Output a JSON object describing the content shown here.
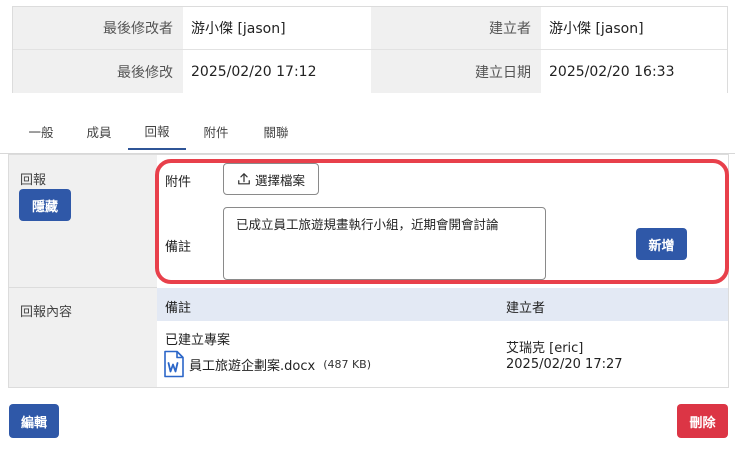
{
  "info": {
    "modifier_label": "最後修改者",
    "modifier_value": "游小傑 [jason]",
    "creator_label": "建立者",
    "creator_value": "游小傑 [jason]",
    "modified_label": "最後修改",
    "modified_value": "2025/02/20 17:12",
    "created_label": "建立日期",
    "created_value": "2025/02/20 16:33"
  },
  "tabs": [
    {
      "label": "一般",
      "active": false
    },
    {
      "label": "成員",
      "active": false
    },
    {
      "label": "回報",
      "active": true
    },
    {
      "label": "附件",
      "active": false
    },
    {
      "label": "關聯",
      "active": false
    }
  ],
  "reply": {
    "section_label": "回報",
    "hide_button": "隱藏",
    "attach_label": "附件",
    "choose_file_button": "選擇檔案",
    "note_label": "備註",
    "note_value": "已成立員工旅遊規畫執行小組，近期會開會討論",
    "add_button": "新增"
  },
  "reply_content": {
    "section_label": "回報內容",
    "columns": [
      "備註",
      "建立者"
    ],
    "rows": [
      {
        "note": "已建立專案",
        "file_name": "員工旅遊企劃案.docx",
        "file_size": "(487 KB)",
        "creator": "艾瑞克 [eric]",
        "date": "2025/02/20 17:27"
      }
    ]
  },
  "footer": {
    "edit_button": "編輯",
    "delete_button": "刪除"
  },
  "colors": {
    "primary": "#2f58a8",
    "danger": "#dc3545",
    "highlight": "#e8404b",
    "header_bg": "#e3e9f4"
  }
}
